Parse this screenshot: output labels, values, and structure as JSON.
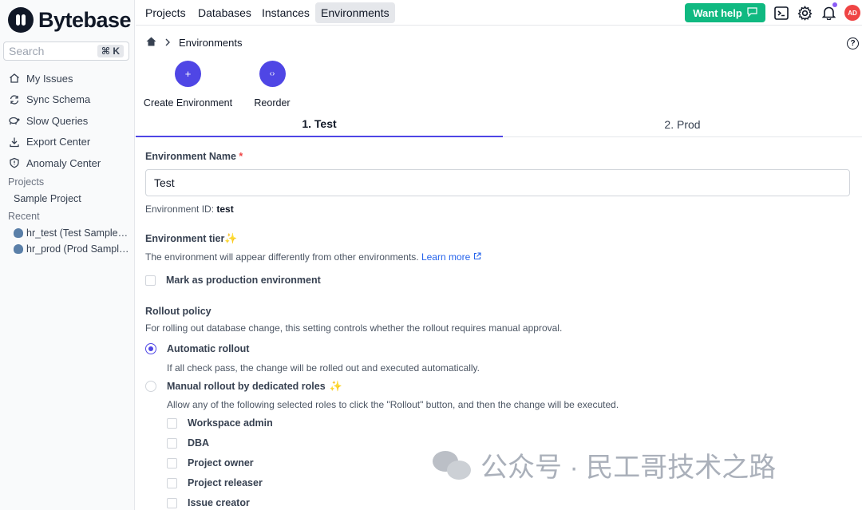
{
  "brand": {
    "name": "Bytebase"
  },
  "search": {
    "placeholder": "Search",
    "shortcut": "⌘ K"
  },
  "sidebar": {
    "items": [
      {
        "label": "My Issues",
        "icon": "home-icon"
      },
      {
        "label": "Sync Schema",
        "icon": "sync-icon"
      },
      {
        "label": "Slow Queries",
        "icon": "turtle-icon"
      },
      {
        "label": "Export Center",
        "icon": "download-icon"
      },
      {
        "label": "Anomaly Center",
        "icon": "shield-icon"
      }
    ],
    "projects_heading": "Projects",
    "projects": [
      "Sample Project"
    ],
    "recent_heading": "Recent",
    "recent": [
      {
        "label": "hr_test (Test Sample Project)",
        "icon": "postgres-icon"
      },
      {
        "label": "hr_prod (Prod Sample Project)",
        "icon": "postgres-icon"
      }
    ]
  },
  "topnav": {
    "tabs": [
      "Projects",
      "Databases",
      "Instances",
      "Environments"
    ],
    "active_tab": "Environments",
    "help_label": "Want help",
    "avatar": "AD"
  },
  "breadcrumb": {
    "current": "Environments"
  },
  "actions": {
    "create": "Create Environment",
    "reorder": "Reorder"
  },
  "env_tabs": [
    "1. Test",
    "2. Prod"
  ],
  "form": {
    "name_label": "Environment Name",
    "required_mark": "*",
    "name_value": "Test",
    "id_label": "Environment ID:",
    "id_value": "test",
    "tier_label": "Environment tier",
    "tier_desc": "The environment will appear differently from other environments.",
    "learn_more": "Learn more",
    "production_checkbox": "Mark as production environment",
    "rollout_label": "Rollout policy",
    "rollout_desc": "For rolling out database change, this setting controls whether the rollout requires manual approval.",
    "auto_rollout": "Automatic rollout",
    "auto_desc": "If all check pass, the change will be rolled out and executed automatically.",
    "manual_rollout": "Manual rollout by dedicated roles",
    "manual_desc": "Allow any of the following selected roles to click the \"Rollout\" button, and then the change will be executed.",
    "roles": [
      "Workspace admin",
      "DBA",
      "Project owner",
      "Project releaser",
      "Issue creator"
    ]
  },
  "watermark": {
    "text": "公众号 · 民工哥技术之路"
  },
  "colors": {
    "accent": "#4f46e5",
    "help_green": "#10b981",
    "avatar_red": "#ef4444"
  }
}
